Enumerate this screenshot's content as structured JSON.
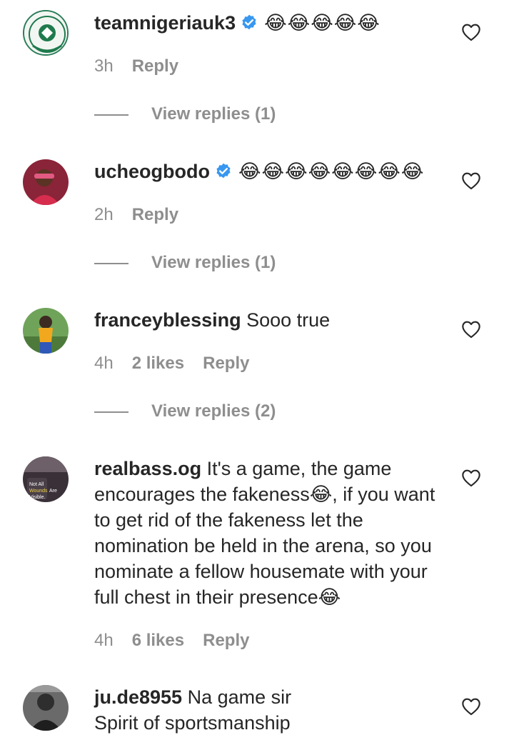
{
  "comments": [
    {
      "username": "teamnigeriauk3",
      "verified": true,
      "text": "😂😂😂😂😂",
      "time": "3h",
      "likes": "",
      "reply_label": "Reply",
      "view_replies": "View replies (1)",
      "avatar_text": "TEAM NIGERIA UK"
    },
    {
      "username": "ucheogbodo",
      "verified": true,
      "text": "😂😂😂😂😂😂😂😂",
      "time": "2h",
      "likes": "",
      "reply_label": "Reply",
      "view_replies": "View replies (1)"
    },
    {
      "username": "franceyblessing",
      "verified": false,
      "text": "Sooo true",
      "time": "4h",
      "likes": "2 likes",
      "reply_label": "Reply",
      "view_replies": "View replies (2)"
    },
    {
      "username": "realbass.og",
      "verified": false,
      "text": "It's a game, the game encourages the fakeness😂, if you want to get rid of the fakeness let the nomination be held in the arena, so you nominate a fellow housemate with your full chest in their presence😂",
      "time": "4h",
      "likes": "6 likes",
      "reply_label": "Reply",
      "avatar_text": "Not All Wounds Are Visible."
    },
    {
      "username": "ju.de8955",
      "verified": false,
      "text": "Na game sir\nSpirit of sportsmanship"
    }
  ],
  "icons": {
    "like": "heart-outline-icon",
    "verified": "verified-badge-icon"
  },
  "colors": {
    "verified_blue": "#3897f0",
    "meta_gray": "#8e8e8e",
    "text": "#262626"
  }
}
